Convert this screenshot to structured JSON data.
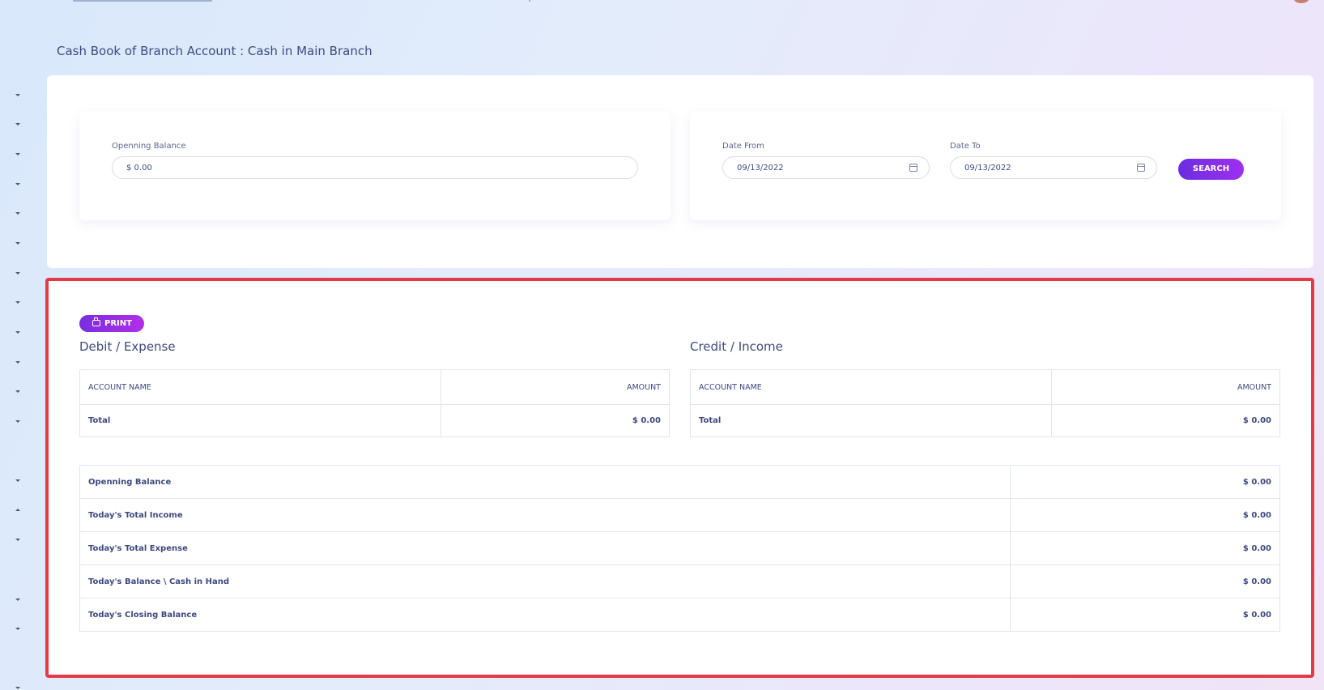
{
  "page": {
    "title": "Cash Book of Branch Account : Cash in Main Branch"
  },
  "filters": {
    "opening_balance_label": "Openning Balance",
    "opening_balance_value": "$ 0.00",
    "date_from_label": "Date From",
    "date_from_value": "09/13/2022",
    "date_to_label": "Date To",
    "date_to_value": "09/13/2022",
    "search_label": "SEARCH"
  },
  "report": {
    "print_label": "PRINT",
    "debit": {
      "title": "Debit / Expense",
      "col_account": "ACCOUNT NAME",
      "col_amount": "AMOUNT",
      "total_label": "Total",
      "total_value": "$ 0.00"
    },
    "credit": {
      "title": "Credit / Income",
      "col_account": "ACCOUNT NAME",
      "col_amount": "AMOUNT",
      "total_label": "Total",
      "total_value": "$ 0.00"
    },
    "summary": [
      {
        "label": "Openning Balance",
        "value": "$ 0.00"
      },
      {
        "label": "Today's Total Income",
        "value": "$ 0.00"
      },
      {
        "label": "Today's Total Expense",
        "value": "$ 0.00"
      },
      {
        "label": "Today's Balance \\ Cash in Hand",
        "value": "$ 0.00"
      },
      {
        "label": "Today's Closing Balance",
        "value": "$ 0.00"
      }
    ]
  },
  "colors": {
    "accent": "#7b2de0",
    "highlight_border": "#e33b45"
  }
}
